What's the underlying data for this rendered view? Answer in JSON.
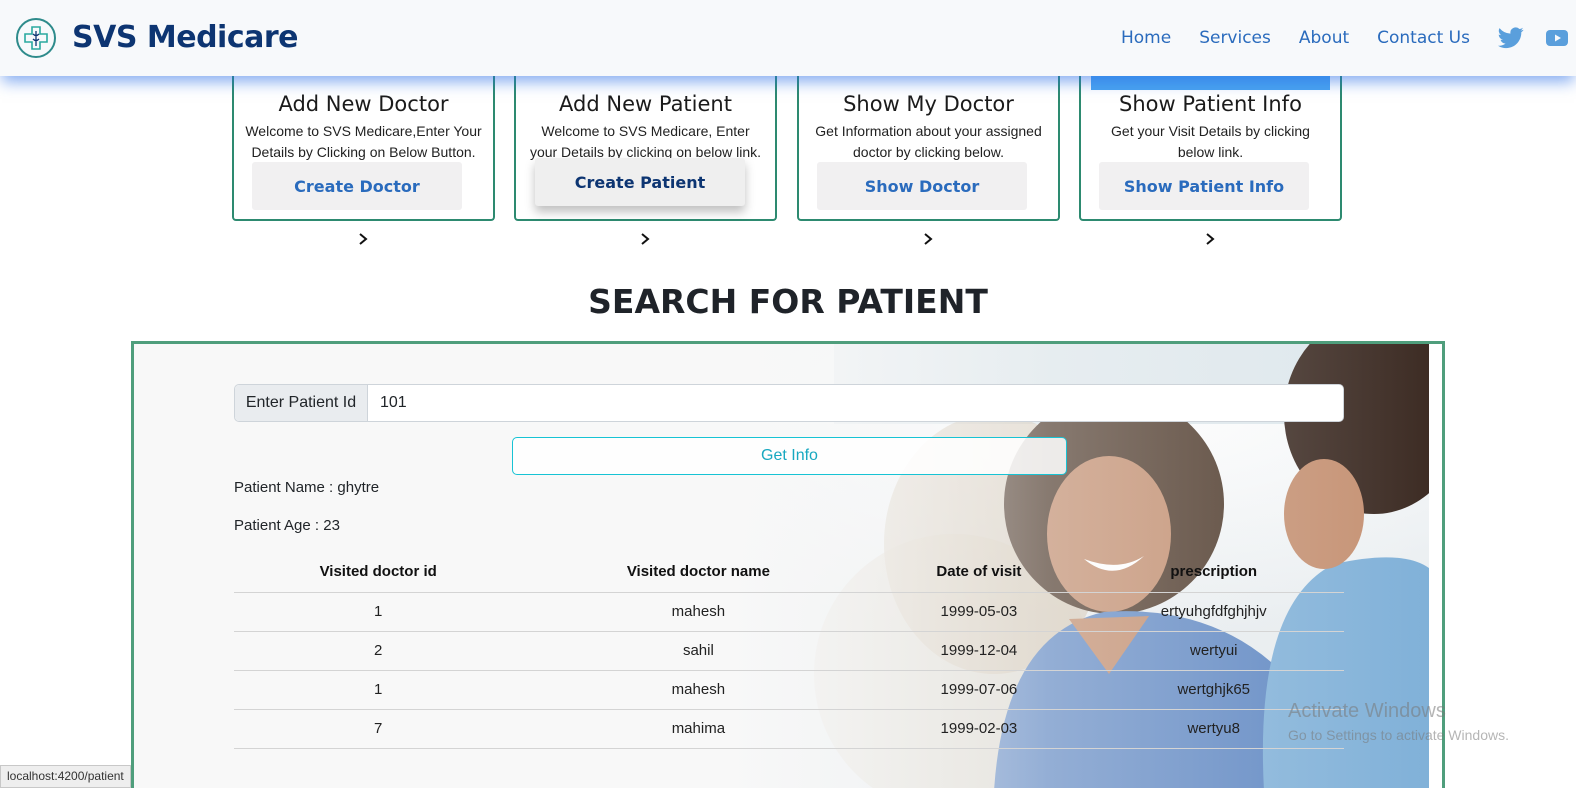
{
  "header": {
    "brand": "SVS Medicare",
    "nav": [
      "Home",
      "Services",
      "About",
      "Contact Us"
    ],
    "social_icons": [
      "twitter-icon",
      "youtube-icon"
    ]
  },
  "cards": [
    {
      "title": "Add New Doctor",
      "desc": "Welcome to SVS Medicare,Enter Your Details by Clicking on Below Button.",
      "button": "Create Doctor"
    },
    {
      "title": "Add New Patient",
      "desc": "Welcome to SVS Medicare, Enter your Details by clicking on below link.",
      "button": "Create Patient"
    },
    {
      "title": "Show My Doctor",
      "desc": "Get Information about your assigned doctor by clicking below.",
      "button": "Show Doctor"
    },
    {
      "title": "Show Patient Info",
      "desc": "Get your Visit Details by clicking below link.",
      "button": "Show Patient Info"
    }
  ],
  "search": {
    "heading": "SEARCH FOR PATIENT",
    "input_label": "Enter Patient Id",
    "input_value": "101",
    "button": "Get Info",
    "patient_name": "Patient Name : ghytre",
    "patient_age": "Patient Age : 23"
  },
  "table": {
    "headers": [
      "Visited doctor id",
      "Visited doctor name",
      "Date of visit",
      "prescription"
    ],
    "rows": [
      [
        "1",
        "mahesh",
        "1999-05-03",
        "ertyuhgfdfghjhjv"
      ],
      [
        "2",
        "sahil",
        "1999-12-04",
        "wertyui"
      ],
      [
        "1",
        "mahesh",
        "1999-07-06",
        "wertghjk65"
      ],
      [
        "7",
        "mahima",
        "1999-02-03",
        "wertyu8"
      ]
    ]
  },
  "watermark": {
    "line1": "Activate Windows",
    "line2": "Go to Settings to activate Windows."
  },
  "statusbar": "localhost:4200/patient",
  "colors": {
    "brand": "#0d3572",
    "link": "#2a6bbd",
    "card_border": "#2d8a70",
    "accent_cyan": "#17c3d4"
  }
}
